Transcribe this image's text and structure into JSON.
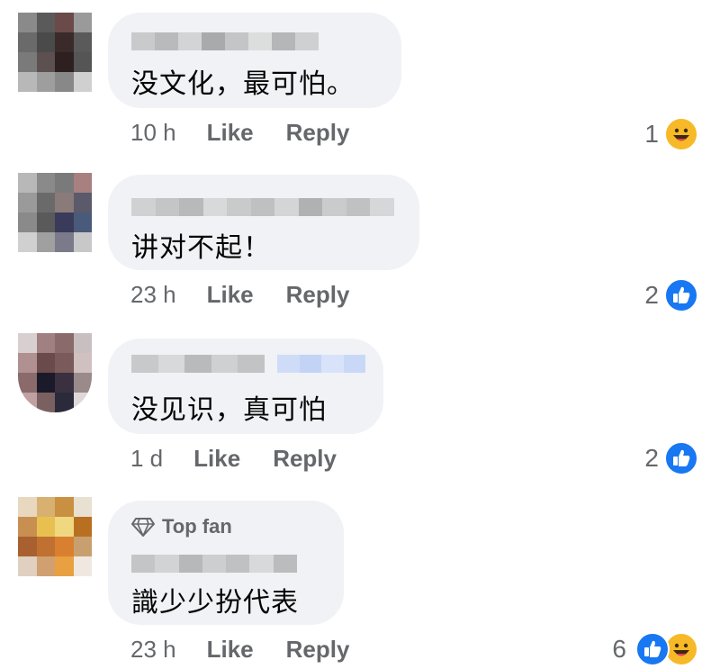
{
  "comments": [
    {
      "text": "没文化，最可怕。",
      "time": "10 h",
      "like": "Like",
      "reply": "Reply",
      "reaction_count": "1",
      "reactions": [
        "haha-icon"
      ]
    },
    {
      "text": "讲对不起！",
      "time": "23 h",
      "like": "Like",
      "reply": "Reply",
      "reaction_count": "2",
      "reactions": [
        "like-icon"
      ]
    },
    {
      "text": "没见识，真可怕",
      "time": "1 d",
      "like": "Like",
      "reply": "Reply",
      "reaction_count": "2",
      "reactions": [
        "like-icon"
      ]
    },
    {
      "badge": "Top fan",
      "text": "識少少扮代表",
      "time": "23 h",
      "like": "Like",
      "reply": "Reply",
      "reaction_count": "6",
      "reactions": [
        "like-icon",
        "haha-icon"
      ]
    }
  ],
  "colors": {
    "bubble": "#f0f2f5",
    "meta": "#65676b",
    "like_blue": "#1877f2",
    "haha_yellow": "#f7b928"
  }
}
